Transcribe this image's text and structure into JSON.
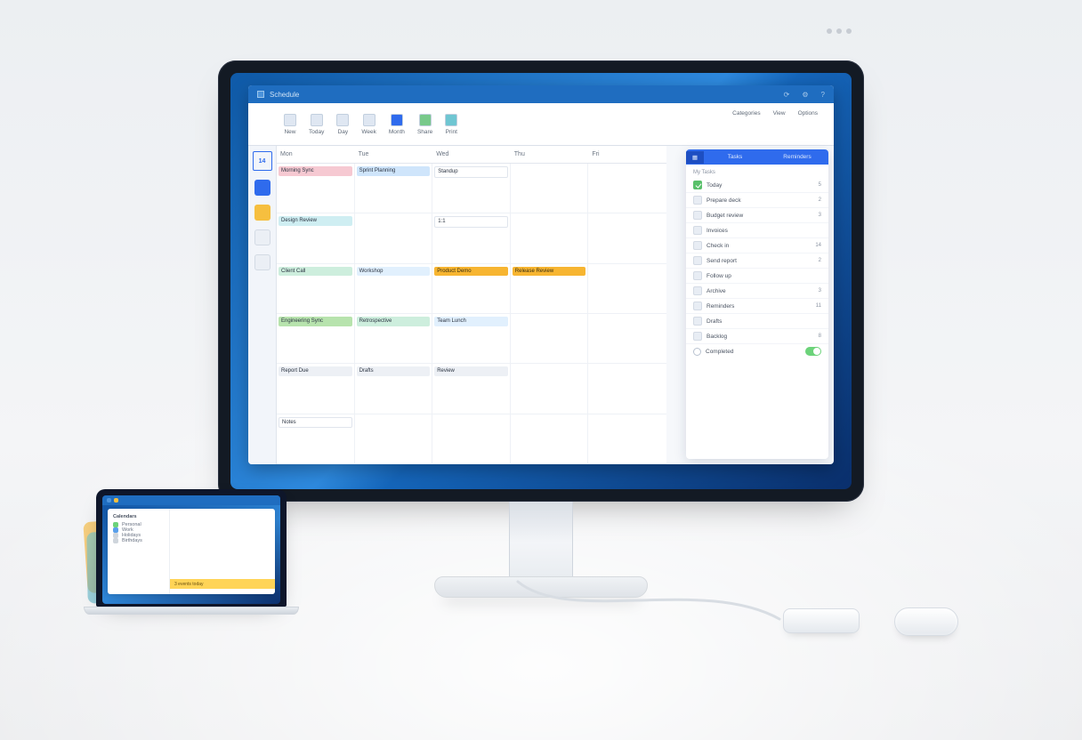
{
  "titlebar": {
    "app_name": "Schedule"
  },
  "titlebar_icons": [
    "sync-icon",
    "settings-icon",
    "help-icon"
  ],
  "ribbon": {
    "groups": [
      {
        "label": "New"
      },
      {
        "label": "Today"
      },
      {
        "label": "Day"
      },
      {
        "label": "Week"
      },
      {
        "label": "Month"
      },
      {
        "label": "Share"
      },
      {
        "label": "Print"
      }
    ],
    "right": {
      "label1": "Categories",
      "label2": "View",
      "label3": "Options"
    }
  },
  "left_rail": {
    "date_label": "14"
  },
  "calendar": {
    "columns": [
      "Mon",
      "Tue",
      "Wed",
      "Thu",
      "Fri"
    ],
    "rows": [
      [
        {
          "cls": "pink",
          "t": "Morning Sync"
        },
        {
          "cls": "blue",
          "t": "Sprint Planning"
        },
        {
          "cls": "white",
          "t": "Standup"
        },
        null,
        null
      ],
      [
        {
          "cls": "cyan",
          "t": "Design Review"
        },
        null,
        {
          "cls": "white",
          "t": "1:1"
        },
        null,
        null
      ],
      [
        {
          "cls": "mint",
          "t": "Client Call"
        },
        {
          "cls": "sky",
          "t": "Workshop"
        },
        {
          "cls": "amber",
          "t": "Product Demo"
        },
        {
          "cls": "amber",
          "t": "Release Review"
        },
        null
      ],
      [
        {
          "cls": "lime",
          "t": "Engineering Sync"
        },
        {
          "cls": "mint",
          "t": "Retrospective"
        },
        {
          "cls": "sky",
          "t": "Team Lunch"
        },
        null,
        null
      ],
      [
        {
          "cls": "pale",
          "t": "Report Due"
        },
        {
          "cls": "pale",
          "t": "Drafts"
        },
        {
          "cls": "pale",
          "t": "Review"
        },
        null,
        null
      ],
      [
        {
          "cls": "white",
          "t": "Notes"
        },
        null,
        null,
        null,
        null
      ]
    ]
  },
  "side_panel": {
    "tabs": [
      "",
      "Tasks",
      "Reminders"
    ],
    "section0": {
      "label": "My Tasks"
    },
    "block_label": "Today",
    "items": [
      {
        "label": "Prepare deck",
        "badge": "2"
      },
      {
        "label": "Budget review",
        "badge": "3"
      },
      {
        "label": "Invoices",
        "badge": ""
      },
      {
        "label": "Check in",
        "badge": "14"
      },
      {
        "label": "Send report",
        "badge": "2"
      },
      {
        "label": "Follow up",
        "badge": ""
      },
      {
        "label": "Archive",
        "badge": "3"
      },
      {
        "label": "Reminders",
        "badge": "11"
      },
      {
        "label": "Drafts",
        "badge": ""
      },
      {
        "label": "Backlog",
        "badge": "8"
      }
    ],
    "toggle_label": "Completed"
  },
  "laptop": {
    "section_title": "Calendars",
    "items": [
      {
        "cls": "green",
        "label": "Personal"
      },
      {
        "cls": "blue",
        "label": "Work"
      },
      {
        "cls": "gray",
        "label": "Holidays"
      },
      {
        "cls": "gray",
        "label": "Birthdays"
      }
    ],
    "status_bar": "3 events today"
  },
  "colors": {
    "brand_blue": "#2f6bed",
    "title_blue": "#1f6dc0",
    "pink": "#f6c9d2",
    "sky": "#e1f0fd",
    "mint": "#cdeedd",
    "lime": "#b7e3ad",
    "amber": "#f7b531",
    "gold": "#f7d66b"
  }
}
